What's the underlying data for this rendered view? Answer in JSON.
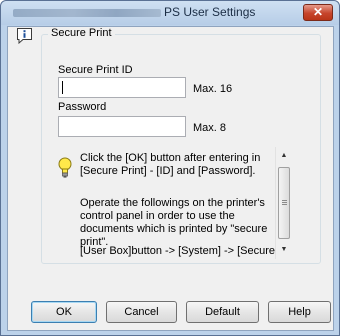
{
  "window": {
    "title": "PS User Settings",
    "close_glyph": "✕"
  },
  "group": {
    "legend": "Secure Print",
    "secure_print_id": {
      "label": "Secure Print ID",
      "value": "",
      "hint": "Max. 16"
    },
    "password": {
      "label": "Password",
      "value": "",
      "hint": "Max. 8"
    }
  },
  "message": {
    "icon": "lightbulb-icon",
    "paragraph1": "Click the [OK] button after entering in [Secure Print] - [ID] and [Password].",
    "paragraph2": "Operate the followings on the printer's control panel in order to use the documents which is printed by \"secure print\".",
    "paragraph3": "[User Box]button -> [System] -> [Secure"
  },
  "scrollbar": {
    "up_glyph": "▲",
    "down_glyph": "▼"
  },
  "buttons": {
    "ok": "OK",
    "cancel": "Cancel",
    "default": "Default",
    "help": "Help"
  }
}
